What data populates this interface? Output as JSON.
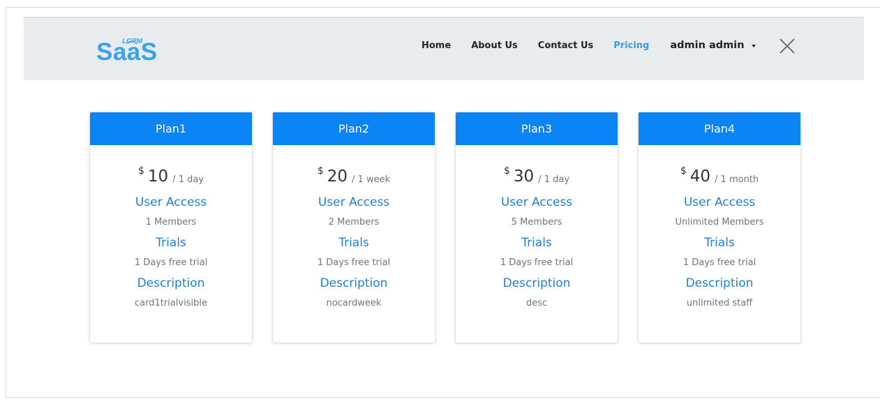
{
  "brand": {
    "logo_small": "LCRM",
    "logo_main": "SaaS",
    "colors": {
      "primary": "#3aa3ea",
      "accent": "#0b84f5",
      "link_active": "#3b9ae8"
    }
  },
  "nav": {
    "links": [
      {
        "label": "Home"
      },
      {
        "label": "About Us"
      },
      {
        "label": "Contact Us"
      },
      {
        "label": "Pricing",
        "active": true
      }
    ],
    "user": "admin admin",
    "close_icon": "close-icon"
  },
  "plans": [
    {
      "name": "Plan1",
      "currency": "$",
      "price": "10",
      "period": "/ 1 day",
      "access_title": "User Access",
      "access_value": "1 Members",
      "trials_title": "Trials",
      "trials_value": "1 Days free trial",
      "desc_title": "Description",
      "desc_value": "card1trialvisible"
    },
    {
      "name": "Plan2",
      "currency": "$",
      "price": "20",
      "period": "/ 1 week",
      "access_title": "User Access",
      "access_value": "2 Members",
      "trials_title": "Trials",
      "trials_value": "1 Days free trial",
      "desc_title": "Description",
      "desc_value": "nocardweek"
    },
    {
      "name": "Plan3",
      "currency": "$",
      "price": "30",
      "period": "/ 1 day",
      "access_title": "User Access",
      "access_value": "5 Members",
      "trials_title": "Trials",
      "trials_value": "1 Days free trial",
      "desc_title": "Description",
      "desc_value": "desc"
    },
    {
      "name": "Plan4",
      "currency": "$",
      "price": "40",
      "period": "/ 1 month",
      "access_title": "User Access",
      "access_value": "Unlimited Members",
      "trials_title": "Trials",
      "trials_value": "1 Days free trial",
      "desc_title": "Description",
      "desc_value": "unlimited staff"
    }
  ]
}
